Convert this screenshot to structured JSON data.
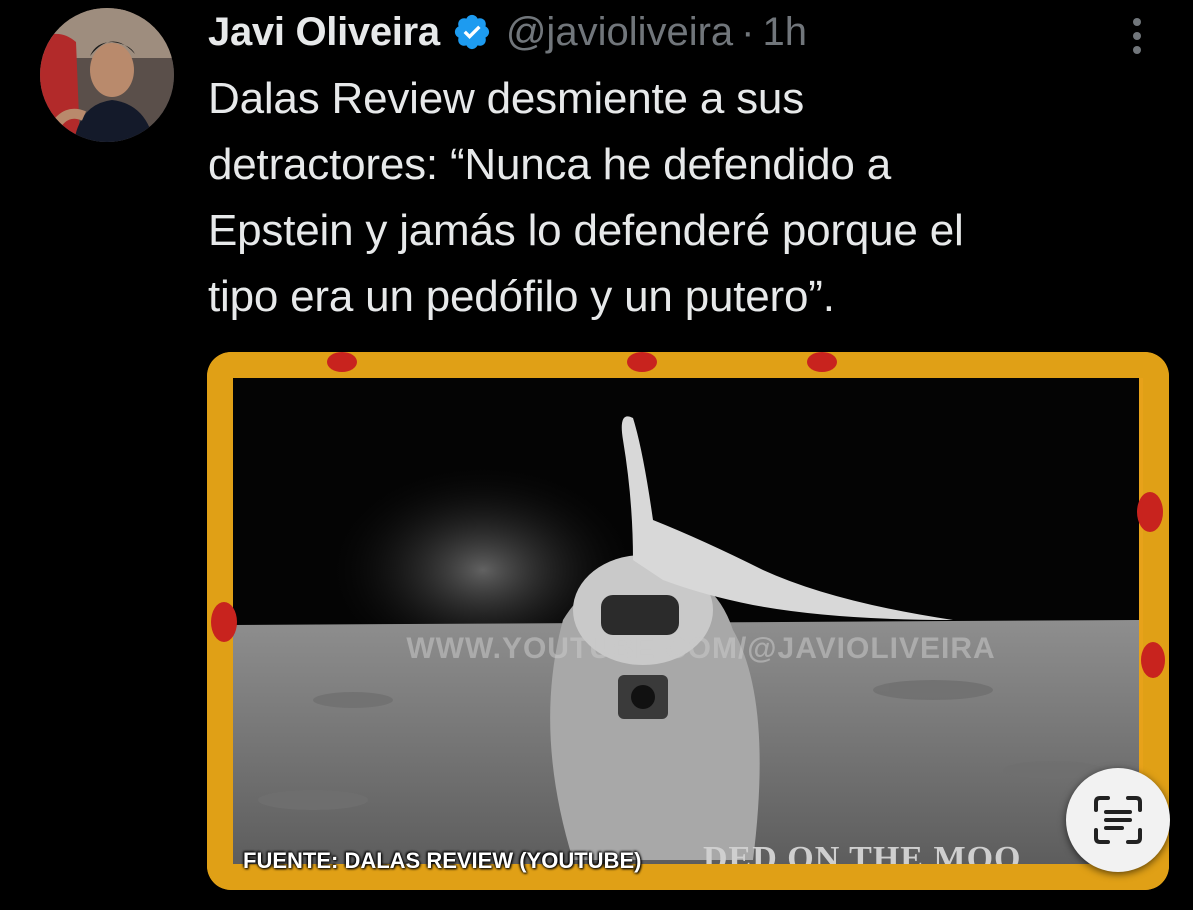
{
  "tweet": {
    "author_name": "Javi Oliveira",
    "handle": "@javioliveira",
    "separator": "·",
    "time": "1h",
    "verified": true,
    "text": "Dalas Review desmiente a sus\ndetractores: “Nunca he defendido a\nEpstein y jamás lo defenderé porque el\ntipo era un pedófilo y un putero”."
  },
  "media": {
    "watermark": "WWW.YOUTUBE.COM/@JAVIOLIVEIRA",
    "caption": "FINALLY WE HAD LANDED ON THE MOON",
    "caption_visible": "DED ON THE MOO",
    "source": "FUENTE: DALAS REVIEW (YOUTUBE)",
    "frame_color": "#e0a016"
  },
  "icons": {
    "verified": "verified-badge-icon",
    "more": "more-vertical-icon",
    "lens": "text-scan-icon"
  },
  "colors": {
    "background": "#000000",
    "text_primary": "#e7e9ea",
    "text_secondary": "#71767b",
    "verified_blue": "#1d9bf0"
  }
}
